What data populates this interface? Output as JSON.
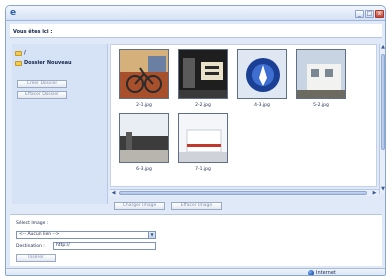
{
  "window": {
    "icon": "ie-icon",
    "controls": {
      "minimize": "_",
      "maximize": "□",
      "close": "x"
    }
  },
  "header": {
    "title": "Vous êtes ici :"
  },
  "sidebar": {
    "root_label": "/",
    "folder_label": "Dossier Nouveau",
    "create_folder_button": "Créer Dossier",
    "delete_folder_button": "Effacer Dossier"
  },
  "gallery": {
    "items": [
      {
        "caption": "2-1.jpg",
        "scene": "photo of a bicycle propped against a painted wall"
      },
      {
        "caption": "2-2.jpg",
        "scene": "photo of a dark storefront with a lit sign"
      },
      {
        "caption": "4-3.jpg",
        "scene": "graphic of a blue circular emblem with a figure"
      },
      {
        "caption": "5-2.jpg",
        "scene": "photo of a white building facade under a bright sky"
      },
      {
        "caption": "6-3.jpg",
        "scene": "photo of a street with a low dark building"
      },
      {
        "caption": "7-1.jpg",
        "scene": "photo of a white building with a red stripe"
      }
    ]
  },
  "actions": {
    "upload_button": "Charger Image",
    "delete_button": "Effacer Image"
  },
  "form": {
    "select_label": "Sélect Image :",
    "select_value": "<-- Aucun lien -->",
    "url_label": "Destination :",
    "url_value": "http://",
    "insert_button": "Insérer"
  },
  "statusbar": {
    "zone": "Internet"
  },
  "colors": {
    "accent": "#2f5fb0",
    "panel": "#dfe9f8",
    "folder": "#f2cb52",
    "close_button": "#c5453a"
  }
}
